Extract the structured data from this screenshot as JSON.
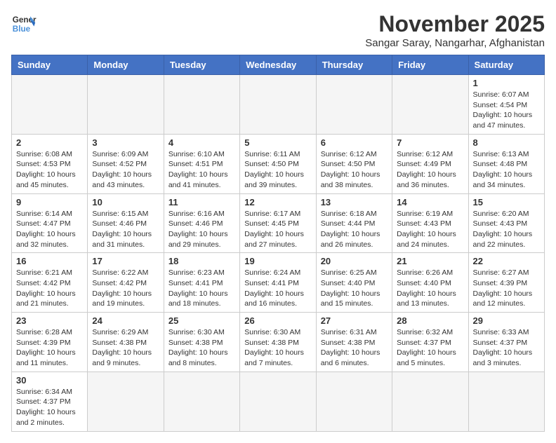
{
  "logo": {
    "text_general": "General",
    "text_blue": "Blue"
  },
  "header": {
    "title": "November 2025",
    "subtitle": "Sangar Saray, Nangarhar, Afghanistan"
  },
  "weekdays": [
    "Sunday",
    "Monday",
    "Tuesday",
    "Wednesday",
    "Thursday",
    "Friday",
    "Saturday"
  ],
  "days": {
    "1": {
      "sunrise": "6:07 AM",
      "sunset": "4:54 PM",
      "daylight": "10 hours and 47 minutes."
    },
    "2": {
      "sunrise": "6:08 AM",
      "sunset": "4:53 PM",
      "daylight": "10 hours and 45 minutes."
    },
    "3": {
      "sunrise": "6:09 AM",
      "sunset": "4:52 PM",
      "daylight": "10 hours and 43 minutes."
    },
    "4": {
      "sunrise": "6:10 AM",
      "sunset": "4:51 PM",
      "daylight": "10 hours and 41 minutes."
    },
    "5": {
      "sunrise": "6:11 AM",
      "sunset": "4:50 PM",
      "daylight": "10 hours and 39 minutes."
    },
    "6": {
      "sunrise": "6:12 AM",
      "sunset": "4:50 PM",
      "daylight": "10 hours and 38 minutes."
    },
    "7": {
      "sunrise": "6:12 AM",
      "sunset": "4:49 PM",
      "daylight": "10 hours and 36 minutes."
    },
    "8": {
      "sunrise": "6:13 AM",
      "sunset": "4:48 PM",
      "daylight": "10 hours and 34 minutes."
    },
    "9": {
      "sunrise": "6:14 AM",
      "sunset": "4:47 PM",
      "daylight": "10 hours and 32 minutes."
    },
    "10": {
      "sunrise": "6:15 AM",
      "sunset": "4:46 PM",
      "daylight": "10 hours and 31 minutes."
    },
    "11": {
      "sunrise": "6:16 AM",
      "sunset": "4:46 PM",
      "daylight": "10 hours and 29 minutes."
    },
    "12": {
      "sunrise": "6:17 AM",
      "sunset": "4:45 PM",
      "daylight": "10 hours and 27 minutes."
    },
    "13": {
      "sunrise": "6:18 AM",
      "sunset": "4:44 PM",
      "daylight": "10 hours and 26 minutes."
    },
    "14": {
      "sunrise": "6:19 AM",
      "sunset": "4:43 PM",
      "daylight": "10 hours and 24 minutes."
    },
    "15": {
      "sunrise": "6:20 AM",
      "sunset": "4:43 PM",
      "daylight": "10 hours and 22 minutes."
    },
    "16": {
      "sunrise": "6:21 AM",
      "sunset": "4:42 PM",
      "daylight": "10 hours and 21 minutes."
    },
    "17": {
      "sunrise": "6:22 AM",
      "sunset": "4:42 PM",
      "daylight": "10 hours and 19 minutes."
    },
    "18": {
      "sunrise": "6:23 AM",
      "sunset": "4:41 PM",
      "daylight": "10 hours and 18 minutes."
    },
    "19": {
      "sunrise": "6:24 AM",
      "sunset": "4:41 PM",
      "daylight": "10 hours and 16 minutes."
    },
    "20": {
      "sunrise": "6:25 AM",
      "sunset": "4:40 PM",
      "daylight": "10 hours and 15 minutes."
    },
    "21": {
      "sunrise": "6:26 AM",
      "sunset": "4:40 PM",
      "daylight": "10 hours and 13 minutes."
    },
    "22": {
      "sunrise": "6:27 AM",
      "sunset": "4:39 PM",
      "daylight": "10 hours and 12 minutes."
    },
    "23": {
      "sunrise": "6:28 AM",
      "sunset": "4:39 PM",
      "daylight": "10 hours and 11 minutes."
    },
    "24": {
      "sunrise": "6:29 AM",
      "sunset": "4:38 PM",
      "daylight": "10 hours and 9 minutes."
    },
    "25": {
      "sunrise": "6:30 AM",
      "sunset": "4:38 PM",
      "daylight": "10 hours and 8 minutes."
    },
    "26": {
      "sunrise": "6:30 AM",
      "sunset": "4:38 PM",
      "daylight": "10 hours and 7 minutes."
    },
    "27": {
      "sunrise": "6:31 AM",
      "sunset": "4:38 PM",
      "daylight": "10 hours and 6 minutes."
    },
    "28": {
      "sunrise": "6:32 AM",
      "sunset": "4:37 PM",
      "daylight": "10 hours and 5 minutes."
    },
    "29": {
      "sunrise": "6:33 AM",
      "sunset": "4:37 PM",
      "daylight": "10 hours and 3 minutes."
    },
    "30": {
      "sunrise": "6:34 AM",
      "sunset": "4:37 PM",
      "daylight": "10 hours and 2 minutes."
    }
  }
}
